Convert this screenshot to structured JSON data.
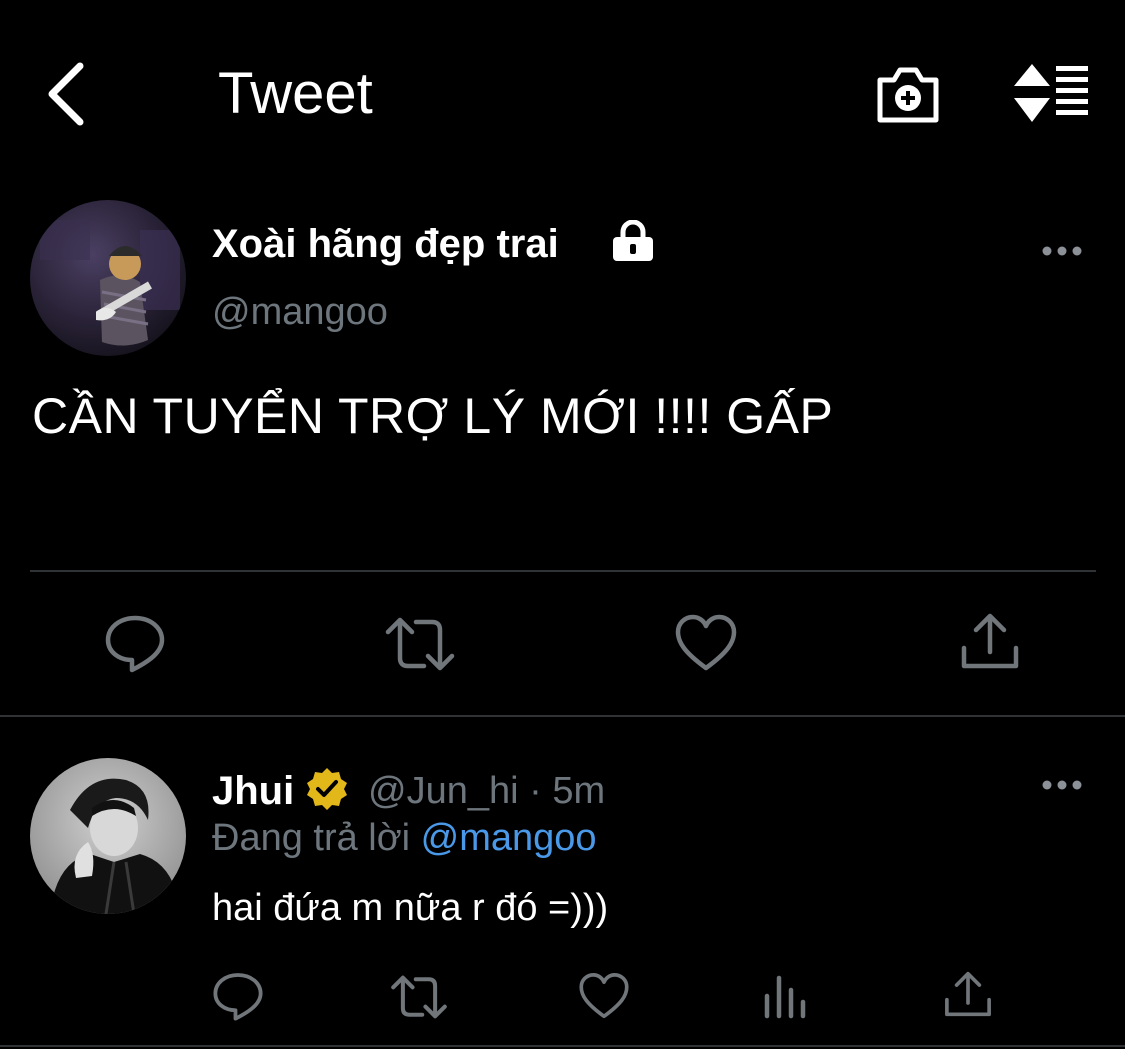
{
  "header": {
    "title": "Tweet",
    "back_icon": "chevron-left-icon",
    "camera_icon": "camera-plus-icon",
    "sort_icon": "sort-list-icon"
  },
  "main_tweet": {
    "author_name": "Xoài hãng đẹp trai",
    "author_handle": "@mangoo",
    "text": "CẦN TUYỂN TRỢ LÝ MỚI !!!! GẤP",
    "protected": true,
    "actions": [
      "reply-icon",
      "retweet-icon",
      "like-icon",
      "share-icon"
    ]
  },
  "reply": {
    "author_name": "Jhui",
    "verified": true,
    "meta": "@Jun_hi · 5m",
    "replying_prefix": "Đang trả lời ",
    "replying_to": "@mangoo",
    "text": "hai đứa m nữa r đó =)))",
    "actions": [
      "reply-icon",
      "retweet-icon",
      "like-icon",
      "views-icon",
      "share-icon"
    ]
  },
  "colors": {
    "background": "#000000",
    "text_primary": "#ffffff",
    "text_secondary": "#6e767d",
    "link": "#4a99e9",
    "icon_gray": "#71767b",
    "divider": "#2f3336",
    "verified_gold": "#e2b719"
  }
}
